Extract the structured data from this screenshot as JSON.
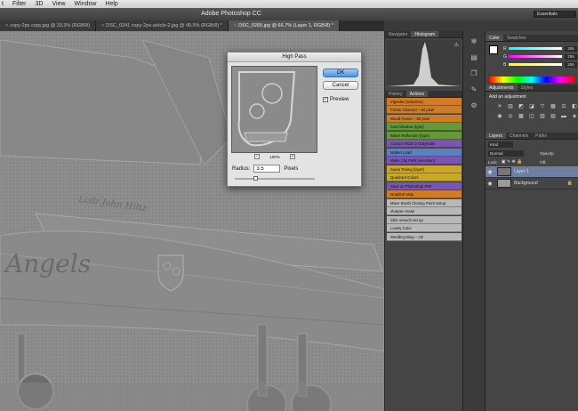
{
  "menubar": {
    "items": [
      "t",
      "Filter",
      "3D",
      "View",
      "Window",
      "Help"
    ]
  },
  "app_title": "Adobe Photoshop CC",
  "workspace": "Essentials",
  "tabs": [
    {
      "label": "copy-2ps copy.jpg @ 33.3% (RGB/8)",
      "active": false
    },
    {
      "label": "DSC_0241 copy-2ps-article-2.jpg @ 40.5% (RGB/8) *",
      "active": false
    },
    {
      "label": "DSC_0265.jpg @ 66.7% (Layer 1, RGB/8) *",
      "active": true
    }
  ],
  "canvas": {
    "name_text": "Lcdr John Hiltz",
    "tail_text": "Angels"
  },
  "dialog": {
    "title": "High Pass",
    "ok": "OK",
    "cancel": "Cancel",
    "preview_label": "Preview",
    "preview_checked": true,
    "zoom": "100%",
    "zoom_minus": "−",
    "zoom_plus": "+",
    "radius_label": "Radius:",
    "radius_value": "3.5",
    "radius_unit": "Pixels",
    "radius_slider_fraction": 0.23
  },
  "panels": {
    "top_tabs": [
      "Navigator",
      "Histogram"
    ],
    "actions_tabs": [
      "History",
      "Actions"
    ],
    "actions": [
      {
        "label": "Vignette (selection)",
        "color": "#d07c25"
      },
      {
        "label": "Frame Channel – 50 pixel",
        "color": "#d07c25"
      },
      {
        "label": "Wood Frame – 50 pixel",
        "color": "#d07c25"
      },
      {
        "label": "Cast Shadow (type)",
        "color": "#66973a"
      },
      {
        "label": "Water Reflection (type)",
        "color": "#66973a"
      },
      {
        "label": "Custom RGB to Grayscale",
        "color": "#7a55b5"
      },
      {
        "label": "Molten Lead",
        "color": "#5c7fc0"
      },
      {
        "label": "Make Clip Path (selection)",
        "color": "#7a55b5"
      },
      {
        "label": "Sepia Toning (layer)",
        "color": "#c9a825"
      },
      {
        "label": "Quadrant Colors",
        "color": "#c9a825"
      },
      {
        "label": "Save as Photoshop PDF",
        "color": "#7a55b5"
      },
      {
        "label": "Gradient Map",
        "color": "#d07c25"
      },
      {
        "label": "Mixer Brush Cloning Paint Setup",
        "color": "#b8b8b8"
      },
      {
        "label": "sharpen mask",
        "color": "#b8b8b8"
      },
      {
        "label": "Skin retouch set up",
        "color": "#b8b8b8"
      },
      {
        "label": "Lovely Color",
        "color": "#b8b8b8"
      },
      {
        "label": "Wedding Blog – LB",
        "color": "#b8b8b8"
      }
    ]
  },
  "color_panel": {
    "tabs": [
      "Color",
      "Swatches"
    ],
    "sliders": [
      {
        "label": "R",
        "value": "255"
      },
      {
        "label": "G",
        "value": "255"
      },
      {
        "label": "B",
        "value": "255"
      }
    ]
  },
  "adjustments": {
    "tabs": [
      "Adjustments",
      "Styles"
    ],
    "heading": "Add an adjustment"
  },
  "layers": {
    "tabs": [
      "Layers",
      "Channels",
      "Paths"
    ],
    "kind": "Kind",
    "blend_mode": "Normal",
    "opacity_label": "Opacity:",
    "lock_label": "Lock:",
    "fill_label": "Fill:",
    "items": [
      {
        "name": "Layer 1",
        "selected": true
      },
      {
        "name": "Background",
        "selected": false
      }
    ]
  }
}
